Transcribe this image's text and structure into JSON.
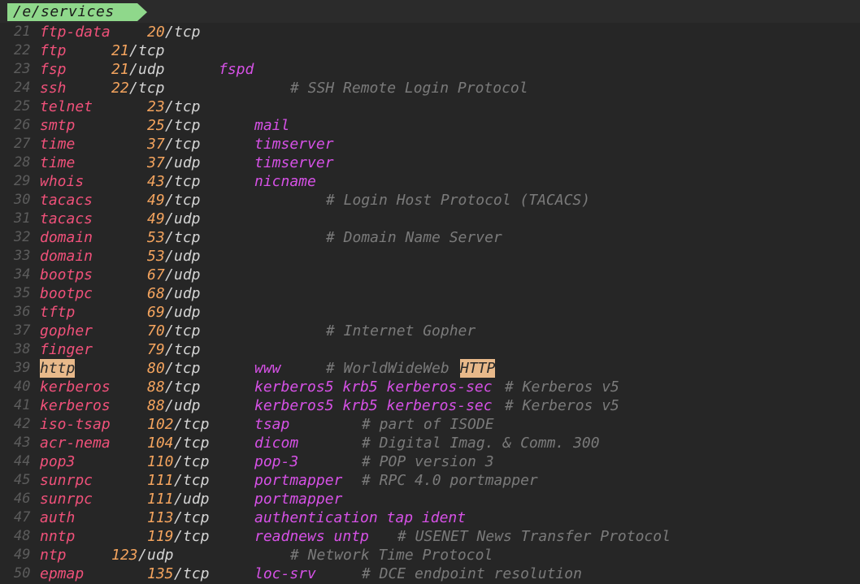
{
  "tab": {
    "title": "/e/services"
  },
  "lines": [
    {
      "n": "21",
      "service": "ftp-data",
      "port": "20",
      "proto": "tcp",
      "aliases": "",
      "comment": "",
      "layout": "a"
    },
    {
      "n": "22",
      "service": "ftp",
      "port": "21",
      "proto": "tcp",
      "aliases": "",
      "comment": "",
      "layout": "b"
    },
    {
      "n": "23",
      "service": "fsp",
      "port": "21",
      "proto": "udp",
      "aliases": "fspd",
      "comment": "",
      "layout": "c"
    },
    {
      "n": "24",
      "service": "ssh",
      "port": "22",
      "proto": "tcp",
      "aliases": "",
      "comment": "# SSH Remote Login Protocol",
      "layout": "d"
    },
    {
      "n": "25",
      "service": "telnet",
      "port": "23",
      "proto": "tcp",
      "aliases": "",
      "comment": "",
      "layout": "e"
    },
    {
      "n": "26",
      "service": "smtp",
      "port": "25",
      "proto": "tcp",
      "aliases": "mail",
      "comment": "",
      "layout": "e"
    },
    {
      "n": "27",
      "service": "time",
      "port": "37",
      "proto": "tcp",
      "aliases": "timserver",
      "comment": "",
      "layout": "e"
    },
    {
      "n": "28",
      "service": "time",
      "port": "37",
      "proto": "udp",
      "aliases": "timserver",
      "comment": "",
      "layout": "e"
    },
    {
      "n": "29",
      "service": "whois",
      "port": "43",
      "proto": "tcp",
      "aliases": "nicname",
      "comment": "",
      "layout": "e"
    },
    {
      "n": "30",
      "service": "tacacs",
      "port": "49",
      "proto": "tcp",
      "aliases": "",
      "comment": "# Login Host Protocol (TACACS)",
      "layout": "f"
    },
    {
      "n": "31",
      "service": "tacacs",
      "port": "49",
      "proto": "udp",
      "aliases": "",
      "comment": "",
      "layout": "e"
    },
    {
      "n": "32",
      "service": "domain",
      "port": "53",
      "proto": "tcp",
      "aliases": "",
      "comment": "# Domain Name Server",
      "layout": "f"
    },
    {
      "n": "33",
      "service": "domain",
      "port": "53",
      "proto": "udp",
      "aliases": "",
      "comment": "",
      "layout": "e"
    },
    {
      "n": "34",
      "service": "bootps",
      "port": "67",
      "proto": "udp",
      "aliases": "",
      "comment": "",
      "layout": "e"
    },
    {
      "n": "35",
      "service": "bootpc",
      "port": "68",
      "proto": "udp",
      "aliases": "",
      "comment": "",
      "layout": "e"
    },
    {
      "n": "36",
      "service": "tftp",
      "port": "69",
      "proto": "udp",
      "aliases": "",
      "comment": "",
      "layout": "e"
    },
    {
      "n": "37",
      "service": "gopher",
      "port": "70",
      "proto": "tcp",
      "aliases": "",
      "comment": "# Internet Gopher",
      "layout": "f"
    },
    {
      "n": "38",
      "service": "finger",
      "port": "79",
      "proto": "tcp",
      "aliases": "",
      "comment": "",
      "layout": "e"
    },
    {
      "n": "39",
      "service": "http",
      "port": "80",
      "proto": "tcp",
      "aliases": "www",
      "comment": "# WorldWideWeb",
      "comment_hl": "HTTP",
      "layout": "f",
      "service_hl": true
    },
    {
      "n": "40",
      "service": "kerberos",
      "port": "88",
      "proto": "tcp",
      "aliases": "kerberos5 krb5 kerberos-sec",
      "comment": "# Kerberos v5",
      "layout": "g"
    },
    {
      "n": "41",
      "service": "kerberos",
      "port": "88",
      "proto": "udp",
      "aliases": "kerberos5 krb5 kerberos-sec",
      "comment": "# Kerberos v5",
      "layout": "g"
    },
    {
      "n": "42",
      "service": "iso-tsap",
      "port": "102",
      "proto": "tcp",
      "aliases": "tsap",
      "comment": "# part of ISODE",
      "layout": "h"
    },
    {
      "n": "43",
      "service": "acr-nema",
      "port": "104",
      "proto": "tcp",
      "aliases": "dicom",
      "comment": "# Digital Imag. & Comm. 300",
      "layout": "h"
    },
    {
      "n": "44",
      "service": "pop3",
      "port": "110",
      "proto": "tcp",
      "aliases": "pop-3",
      "comment": "# POP version 3",
      "layout": "h"
    },
    {
      "n": "45",
      "service": "sunrpc",
      "port": "111",
      "proto": "tcp",
      "aliases": "portmapper",
      "comment": "# RPC 4.0 portmapper",
      "layout": "h"
    },
    {
      "n": "46",
      "service": "sunrpc",
      "port": "111",
      "proto": "udp",
      "aliases": "portmapper",
      "comment": "",
      "layout": "h"
    },
    {
      "n": "47",
      "service": "auth",
      "port": "113",
      "proto": "tcp",
      "aliases": "authentication tap ident",
      "comment": "",
      "layout": "h"
    },
    {
      "n": "48",
      "service": "nntp",
      "port": "119",
      "proto": "tcp",
      "aliases": "readnews untp",
      "comment": "# USENET News Transfer Protocol",
      "layout": "i"
    },
    {
      "n": "49",
      "service": "ntp",
      "port": "123",
      "proto": "udp",
      "aliases": "",
      "comment": "# Network Time Protocol",
      "layout": "j"
    },
    {
      "n": "50",
      "service": "epmap",
      "port": "135",
      "proto": "tcp",
      "aliases": "loc-srv",
      "comment": "# DCE endpoint resolution",
      "layout": "h"
    }
  ]
}
